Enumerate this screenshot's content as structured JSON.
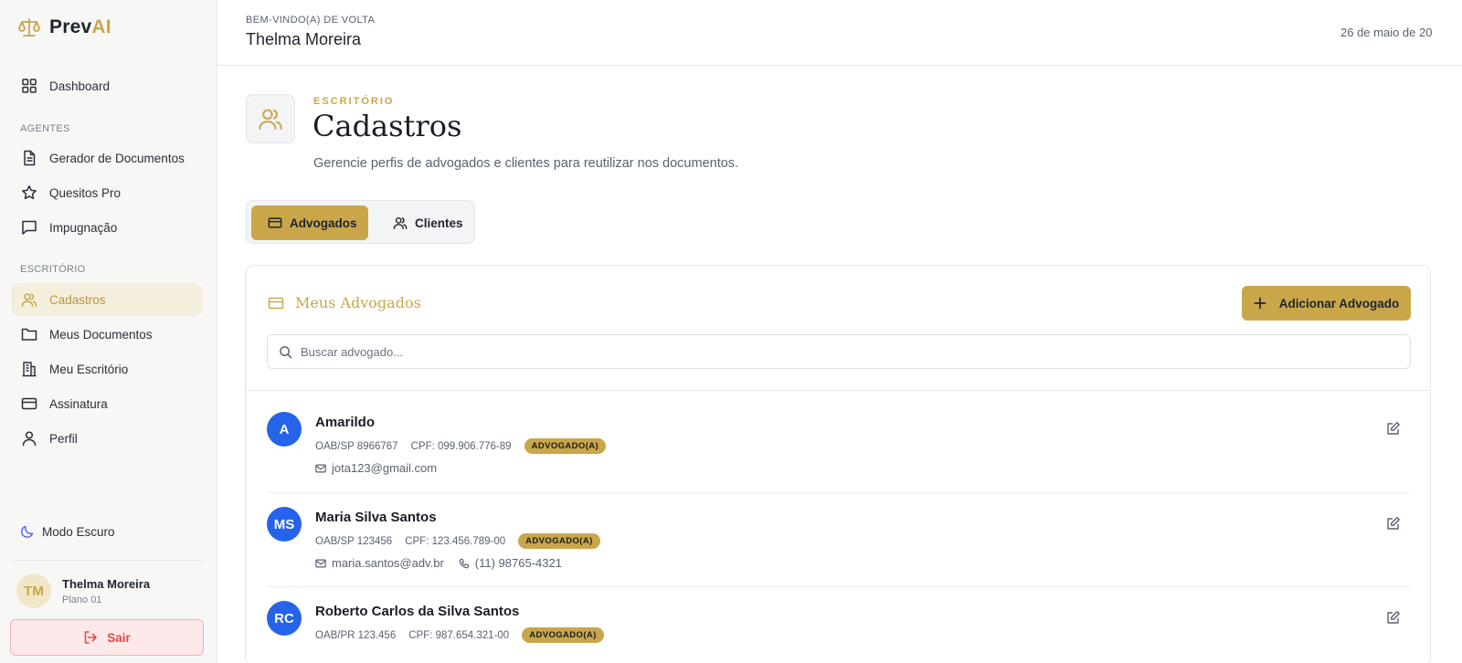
{
  "brand": {
    "name_part1": "Prev",
    "name_part2": "AI"
  },
  "sidebar": {
    "dashboard": "Dashboard",
    "section_agentes": "AGENTES",
    "agentes": [
      "Gerador de Documentos",
      "Quesitos Pro",
      "Impugnação"
    ],
    "section_escritorio": "ESCRITÓRIO",
    "escritorio": [
      "Cadastros",
      "Meus Documentos",
      "Meu Escritório",
      "Assinatura",
      "Perfil"
    ],
    "dark_mode": "Modo Escuro",
    "user": {
      "initials": "TM",
      "name": "Thelma Moreira",
      "plan": "Plano 01"
    },
    "logout": "Sair"
  },
  "header": {
    "welcome": "BEM-VINDO(A) DE VOLTA",
    "user_name": "Thelma Moreira",
    "date": "26 de maio de 20"
  },
  "page": {
    "eyebrow": "ESCRITÓRIO",
    "title": "Cadastros",
    "subtitle": "Gerencie perfis de advogados e clientes para reutilizar nos documentos."
  },
  "tabs": {
    "advogados": "Advogados",
    "clientes": "Clientes"
  },
  "card": {
    "title": "Meus Advogados",
    "add_button": "Adicionar Advogado",
    "search_placeholder": "Buscar advogado..."
  },
  "lawyers": [
    {
      "initials": "A",
      "name": "Amarildo",
      "oab": "OAB/SP 8966767",
      "cpf": "CPF: 099.906.776-89",
      "badge": "ADVOGADO(A)",
      "email": "jota123@gmail.com",
      "phone": ""
    },
    {
      "initials": "MS",
      "name": "Maria Silva Santos",
      "oab": "OAB/SP 123456",
      "cpf": "CPF: 123.456.789-00",
      "badge": "ADVOGADO(A)",
      "email": "maria.santos@adv.br",
      "phone": "(11) 98765-4321"
    },
    {
      "initials": "RC",
      "name": "Roberto Carlos da Silva Santos",
      "oab": "OAB/PR 123.456",
      "cpf": "CPF: 987.654.321-00",
      "badge": "ADVOGADO(A)",
      "email": "",
      "phone": ""
    }
  ],
  "colors": {
    "accent": "#c9a64a",
    "avatar_blue": "#2563eb",
    "logout_red": "#e04b4b"
  }
}
